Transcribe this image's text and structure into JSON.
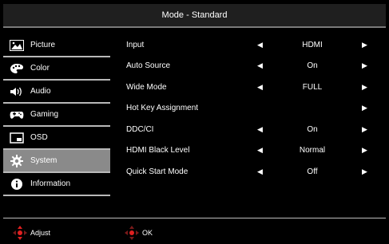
{
  "header": {
    "title": "Mode - Standard"
  },
  "sidebar": {
    "items": [
      {
        "label": "Picture",
        "icon": "picture-icon",
        "active": false
      },
      {
        "label": "Color",
        "icon": "palette-icon",
        "active": false
      },
      {
        "label": "Audio",
        "icon": "speaker-icon",
        "active": false
      },
      {
        "label": "Gaming",
        "icon": "gamepad-icon",
        "active": false
      },
      {
        "label": "OSD",
        "icon": "osd-window-icon",
        "active": false
      },
      {
        "label": "System",
        "icon": "gear-icon",
        "active": true
      },
      {
        "label": "Information",
        "icon": "info-icon",
        "active": false
      }
    ]
  },
  "settings": {
    "rows": [
      {
        "label": "Input",
        "value": "HDMI",
        "left_arrow": true,
        "right_arrow": true
      },
      {
        "label": "Auto Source",
        "value": "On",
        "left_arrow": true,
        "right_arrow": true
      },
      {
        "label": "Wide Mode",
        "value": "FULL",
        "left_arrow": true,
        "right_arrow": true
      },
      {
        "label": "Hot Key Assignment",
        "value": "",
        "left_arrow": false,
        "right_arrow": true
      },
      {
        "label": "DDC/CI",
        "value": "On",
        "left_arrow": true,
        "right_arrow": true
      },
      {
        "label": "HDMI Black Level",
        "value": "Normal",
        "left_arrow": true,
        "right_arrow": true
      },
      {
        "label": "Quick Start Mode",
        "value": "Off",
        "left_arrow": true,
        "right_arrow": true
      }
    ],
    "arrow_left_glyph": "◀",
    "arrow_right_glyph": "▶"
  },
  "footer": {
    "adjust_label": "Adjust",
    "ok_label": "OK"
  },
  "colors": {
    "background": "#000000",
    "active_item": "#8a8a8a",
    "divider": "#b8b8b8",
    "joystick_accent": "#e02020"
  }
}
